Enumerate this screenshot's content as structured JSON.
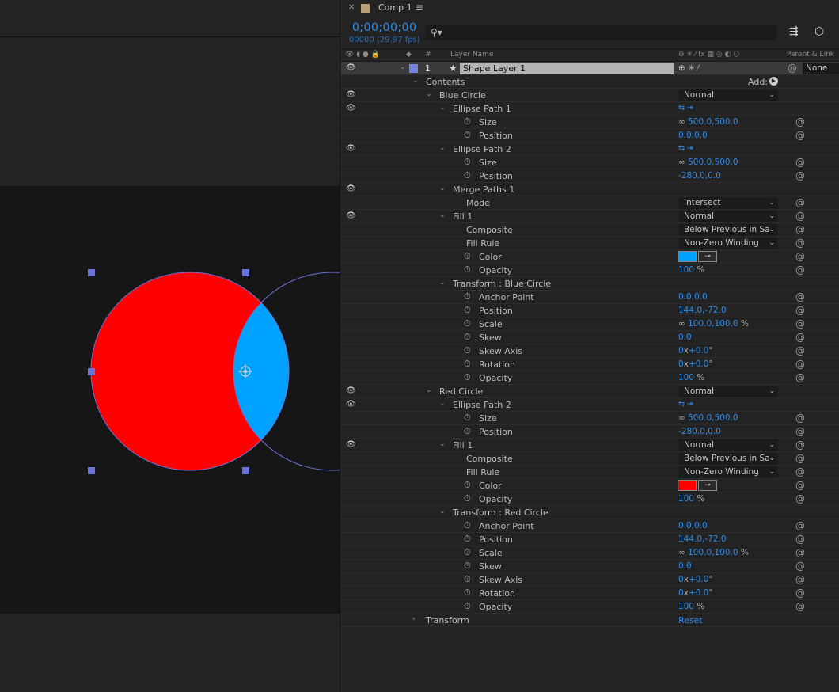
{
  "comp": {
    "tab_label": "Comp 1",
    "timecode": "0;00;00;00",
    "frames": "00000 (29.97 fps)"
  },
  "columns": {
    "hash": "#",
    "layer_name": "Layer Name",
    "parent": "Parent & Link"
  },
  "layer": {
    "number": "1",
    "name": "Shape Layer 1",
    "parent": "None"
  },
  "labels": {
    "contents": "Contents",
    "add": "Add:",
    "transform": "Transform",
    "reset": "Reset"
  },
  "blue_circle": {
    "name": "Blue Circle",
    "blend": "Normal",
    "ellipse1": {
      "name": "Ellipse Path 1",
      "size_label": "Size",
      "size": "500.0,500.0",
      "position_label": "Position",
      "position": "0.0,0.0"
    },
    "ellipse2": {
      "name": "Ellipse Path 2",
      "size_label": "Size",
      "size": "500.0,500.0",
      "position_label": "Position",
      "position": "-280.0,0.0"
    },
    "merge": {
      "name": "Merge Paths 1",
      "mode_label": "Mode",
      "mode": "Intersect"
    },
    "fill": {
      "name": "Fill 1",
      "blend": "Normal",
      "composite_label": "Composite",
      "composite": "Below Previous in Sa",
      "fill_rule_label": "Fill Rule",
      "fill_rule": "Non-Zero Winding",
      "color_label": "Color",
      "color": "#00a2ff",
      "opacity_label": "Opacity",
      "opacity": "100"
    },
    "transform": {
      "name": "Transform : Blue Circle",
      "anchor_label": "Anchor Point",
      "anchor": "0.0,0.0",
      "position_label": "Position",
      "position": "144.0,-72.0",
      "scale_label": "Scale",
      "scale": "100.0,100.0",
      "skew_label": "Skew",
      "skew": "0.0",
      "skew_axis_label": "Skew Axis",
      "skew_axis_rev": "0",
      "skew_axis_deg": "+0.0",
      "rotation_label": "Rotation",
      "rotation_rev": "0",
      "rotation_deg": "+0.0",
      "opacity_label": "Opacity",
      "opacity": "100"
    }
  },
  "red_circle": {
    "name": "Red Circle",
    "blend": "Normal",
    "ellipse2": {
      "name": "Ellipse Path 2",
      "size_label": "Size",
      "size": "500.0,500.0",
      "position_label": "Position",
      "position": "-280.0,0.0"
    },
    "fill": {
      "name": "Fill 1",
      "blend": "Normal",
      "composite_label": "Composite",
      "composite": "Below Previous in Sa",
      "fill_rule_label": "Fill Rule",
      "fill_rule": "Non-Zero Winding",
      "color_label": "Color",
      "color": "#ff0000",
      "opacity_label": "Opacity",
      "opacity": "100"
    },
    "transform": {
      "name": "Transform : Red Circle",
      "anchor_label": "Anchor Point",
      "anchor": "0.0,0.0",
      "position_label": "Position",
      "position": "144.0,-72.0",
      "scale_label": "Scale",
      "scale": "100.0,100.0",
      "skew_label": "Skew",
      "skew": "0.0",
      "skew_axis_label": "Skew Axis",
      "skew_axis_rev": "0",
      "skew_axis_deg": "+0.0",
      "rotation_label": "Rotation",
      "rotation_rev": "0",
      "rotation_deg": "+0.0",
      "opacity_label": "Opacity",
      "opacity": "100"
    }
  },
  "units": {
    "percent": "%",
    "x": "x",
    "deg": "°"
  },
  "colors": {
    "accent": "#2d8ceb",
    "red_fill": "#ff0000",
    "blue_fill": "#00a2ff",
    "path_outline": "#6a73d6"
  }
}
